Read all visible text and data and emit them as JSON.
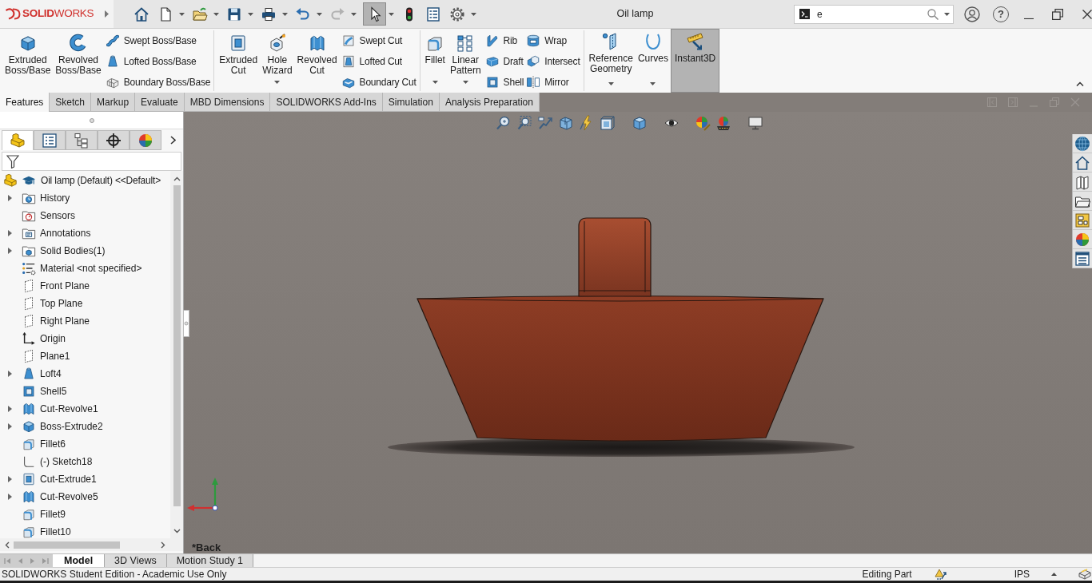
{
  "app": {
    "logo": "**SOLID**WORKS"
  },
  "window": {
    "title": "Oil lamp",
    "help_glyph": "?"
  },
  "quick_access": [
    {
      "kind": "home",
      "dropdown": false,
      "disabled": false,
      "pressed": false
    },
    {
      "kind": "new",
      "dropdown": true,
      "disabled": false,
      "pressed": false
    },
    {
      "kind": "open",
      "dropdown": true,
      "disabled": false,
      "pressed": false
    },
    {
      "kind": "save",
      "dropdown": true,
      "disabled": false,
      "pressed": false
    },
    {
      "kind": "print",
      "dropdown": true,
      "disabled": false,
      "pressed": false
    },
    {
      "kind": "undo",
      "dropdown": true,
      "disabled": false,
      "pressed": false
    },
    {
      "kind": "redo",
      "dropdown": true,
      "disabled": true,
      "pressed": false
    },
    {
      "kind": "select",
      "dropdown": true,
      "disabled": false,
      "pressed": true
    },
    {
      "kind": "rebuild",
      "dropdown": false,
      "disabled": false,
      "pressed": false
    },
    {
      "kind": "properties",
      "dropdown": false,
      "disabled": false,
      "pressed": false
    },
    {
      "kind": "options",
      "dropdown": true,
      "disabled": false,
      "pressed": false
    }
  ],
  "search": {
    "value": "e"
  },
  "ribbon": {
    "groups": [
      {
        "large": [
          {
            "kind": "extrude",
            "label": "Extruded Boss/Base",
            "dropdown": false,
            "pressed": false
          },
          {
            "kind": "revolve",
            "label": "Revolved Boss/Base",
            "dropdown": false,
            "pressed": false
          }
        ],
        "columns": [
          [
            {
              "kind": "sweep",
              "label": "Swept Boss/Base"
            },
            {
              "kind": "loft",
              "label": "Lofted Boss/Base"
            },
            {
              "kind": "boundary",
              "label": "Boundary Boss/Base"
            }
          ]
        ]
      },
      {
        "large": [
          {
            "kind": "extcut",
            "label": "Extruded Cut",
            "dropdown": false,
            "pressed": false
          },
          {
            "kind": "hole",
            "label": "Hole Wizard",
            "dropdown": true,
            "pressed": false
          },
          {
            "kind": "revcut",
            "label": "Revolved Cut",
            "dropdown": false,
            "pressed": false
          }
        ],
        "columns": [
          [
            {
              "kind": "sweptcut",
              "label": "Swept Cut"
            },
            {
              "kind": "loftedcut",
              "label": "Lofted Cut"
            },
            {
              "kind": "boundarycut",
              "label": "Boundary Cut"
            }
          ]
        ]
      },
      {
        "large": [
          {
            "kind": "fillet",
            "label": "Fillet",
            "dropdown": true,
            "pressed": false
          },
          {
            "kind": "pattern",
            "label": "Linear Pattern",
            "dropdown": true,
            "pressed": false
          }
        ],
        "columns": [
          [
            {
              "kind": "rib",
              "label": "Rib"
            },
            {
              "kind": "draft",
              "label": "Draft"
            },
            {
              "kind": "shell",
              "label": "Shell"
            }
          ],
          [
            {
              "kind": "wrap",
              "label": "Wrap"
            },
            {
              "kind": "intersect",
              "label": "Intersect"
            },
            {
              "kind": "mirror",
              "label": "Mirror"
            }
          ]
        ]
      },
      {
        "large": [
          {
            "kind": "refgeom",
            "label": "Reference Geometry",
            "dropdown": true,
            "pressed": false
          },
          {
            "kind": "curves",
            "label": "Curves",
            "dropdown": true,
            "pressed": false
          },
          {
            "kind": "instant3d",
            "label": "Instant3D",
            "dropdown": false,
            "pressed": true
          }
        ]
      }
    ]
  },
  "ribbon_tabs": [
    {
      "label": "Features",
      "selected": true
    },
    {
      "label": "Sketch",
      "selected": false
    },
    {
      "label": "Markup",
      "selected": false
    },
    {
      "label": "Evaluate",
      "selected": false
    },
    {
      "label": "MBD Dimensions",
      "selected": false
    },
    {
      "label": "SOLIDWORKS Add-Ins",
      "selected": false
    },
    {
      "label": "Simulation",
      "selected": false
    },
    {
      "label": "Analysis Preparation",
      "selected": false
    }
  ],
  "panel_tabs": [
    {
      "kind": "features",
      "selected": true
    },
    {
      "kind": "properties",
      "selected": false
    },
    {
      "kind": "configurations",
      "selected": false
    },
    {
      "kind": "dimxpert",
      "selected": false
    },
    {
      "kind": "display",
      "selected": false
    }
  ],
  "feature_tree": {
    "root": {
      "label": "Oil lamp (Default) <<Default>"
    },
    "items": [
      {
        "kind": "history",
        "label": "History",
        "expanded": false
      },
      {
        "kind": "sensors",
        "label": "Sensors"
      },
      {
        "kind": "annotations",
        "label": "Annotations",
        "expanded": false
      },
      {
        "kind": "bodies",
        "label": "Solid Bodies(1)",
        "expanded": false
      },
      {
        "kind": "material",
        "label": "Material <not specified>"
      },
      {
        "kind": "plane",
        "label": "Front Plane"
      },
      {
        "kind": "plane",
        "label": "Top Plane"
      },
      {
        "kind": "plane",
        "label": "Right Plane"
      },
      {
        "kind": "origin",
        "label": "Origin"
      },
      {
        "kind": "plane",
        "label": "Plane1"
      },
      {
        "kind": "loft",
        "label": "Loft4",
        "expanded": false
      },
      {
        "kind": "shell",
        "label": "Shell5"
      },
      {
        "kind": "revcut",
        "label": "Cut-Revolve1",
        "expanded": false
      },
      {
        "kind": "extrude",
        "label": "Boss-Extrude2",
        "expanded": false
      },
      {
        "kind": "fillet",
        "label": "Fillet6"
      },
      {
        "kind": "sketch",
        "label": "(-) Sketch18"
      },
      {
        "kind": "extcut",
        "label": "Cut-Extrude1",
        "expanded": false
      },
      {
        "kind": "revcut",
        "label": "Cut-Revolve5",
        "expanded": false
      },
      {
        "kind": "fillet",
        "label": "Fillet9"
      },
      {
        "kind": "fillet",
        "label": "Fillet10"
      }
    ]
  },
  "viewport": {
    "view_label": "*Back"
  },
  "document_tabs": [
    {
      "label": "Model",
      "selected": true
    },
    {
      "label": "3D Views",
      "selected": false
    },
    {
      "label": "Motion Study 1",
      "selected": false
    }
  ],
  "status_bar": {
    "text": "SOLIDWORKS Student Edition - Academic Use Only",
    "mode": "Editing Part",
    "units": "IPS"
  }
}
